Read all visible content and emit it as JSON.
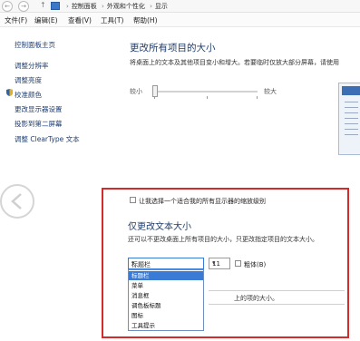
{
  "nav": {
    "back_icon": "back-arrow-icon",
    "forward_icon": "forward-arrow-icon",
    "up_icon": "up-arrow-icon"
  },
  "breadcrumb": {
    "items": [
      "控制面板",
      "外观和个性化",
      "显示"
    ]
  },
  "menu": {
    "file": "文件(F)",
    "edit": "编辑(E)",
    "view": "查看(V)",
    "tools": "工具(T)",
    "help": "帮助(H)"
  },
  "sidebar": {
    "home": "控制面板主页",
    "items": [
      "调整分辨率",
      "调整亮度",
      "校准颜色",
      "更改显示器设置",
      "投影到第二屏幕",
      "调整 ClearType 文本"
    ]
  },
  "main": {
    "title": "更改所有项目的大小",
    "description": "将桌面上的文本及其他项目变小和增大。若要临时仅放大部分屏幕，请使用",
    "slider": {
      "min_label": "较小",
      "max_label": "较大",
      "value_fraction": 0.0
    }
  },
  "scale_option": {
    "checkbox_label": "让我选择一个适合我的所有显示器的缩放级别",
    "checked": false
  },
  "text_size": {
    "title": "仅更改文本大小",
    "description": "还可以不更改桌面上所有项目的大小，只更改指定项目的文本大小。",
    "item_select": "标题栏",
    "size_select": "11",
    "bold_label": "粗体(B)",
    "bold_checked": false,
    "dropdown_options": [
      "标题栏",
      "菜单",
      "消息框",
      "调色板标题",
      "图标",
      "工具提示"
    ],
    "selected_index": 0,
    "hint_text": "上的项的大小。"
  },
  "colors": {
    "highlight_border": "#d42a2a",
    "selection": "#3a7bd5",
    "heading": "#1e3d6e",
    "link": "#1f3f73"
  }
}
